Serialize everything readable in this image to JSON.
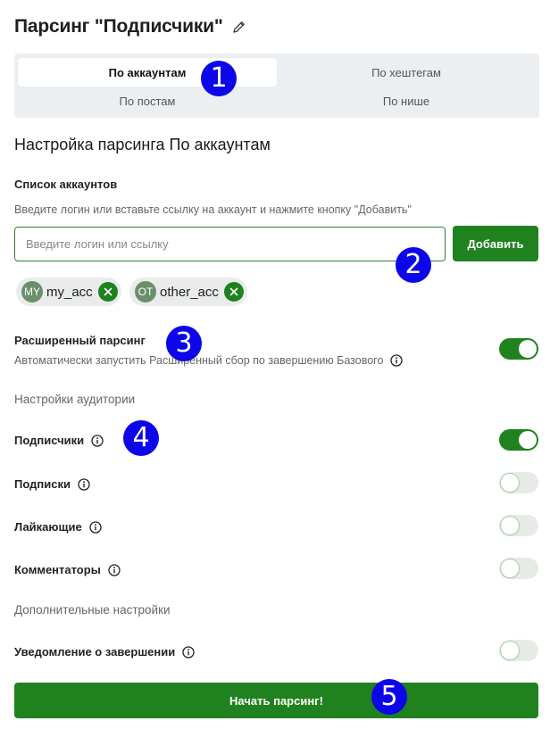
{
  "header": {
    "title": "Парсинг \"Подписчики\"",
    "edit_icon": "pencil-icon"
  },
  "tabs": [
    {
      "label": "По аккаунтам",
      "active": true
    },
    {
      "label": "По хештегам",
      "active": false
    },
    {
      "label": "По постам",
      "active": false
    },
    {
      "label": "По нише",
      "active": false
    }
  ],
  "section": {
    "title": "Настройка парсинга По аккаунтам"
  },
  "accounts": {
    "label": "Список аккаунтов",
    "hint": "Введите логин или вставьте ссылку на аккаунт и нажмите кнопку \"Добавить\"",
    "input_placeholder": "Введите логин или ссылку",
    "input_value": "",
    "add_button": "Добавить",
    "chips": [
      {
        "initials": "MY",
        "name": "my_acc"
      },
      {
        "initials": "OT",
        "name": "other_acc"
      }
    ]
  },
  "extended": {
    "label": "Расширенный парсинг",
    "description": "Автоматически запустить Расширенный сбор по завершению Базового",
    "enabled": true
  },
  "audience": {
    "group_label": "Настройки аудитории",
    "items": [
      {
        "label": "Подписчики",
        "enabled": true
      },
      {
        "label": "Подписки",
        "enabled": false
      },
      {
        "label": "Лайкающие",
        "enabled": false
      },
      {
        "label": "Комментаторы",
        "enabled": false
      }
    ]
  },
  "additional": {
    "group_label": "Дополнительные настройки",
    "notify_label": "Уведомление о завершении",
    "notify_enabled": false
  },
  "start_button": "Начать парсинг!",
  "markers": [
    "1",
    "2",
    "3",
    "4",
    "5"
  ],
  "colors": {
    "accent": "#1f821f",
    "marker": "#0d06e8",
    "tab_background": "#eceff1"
  }
}
